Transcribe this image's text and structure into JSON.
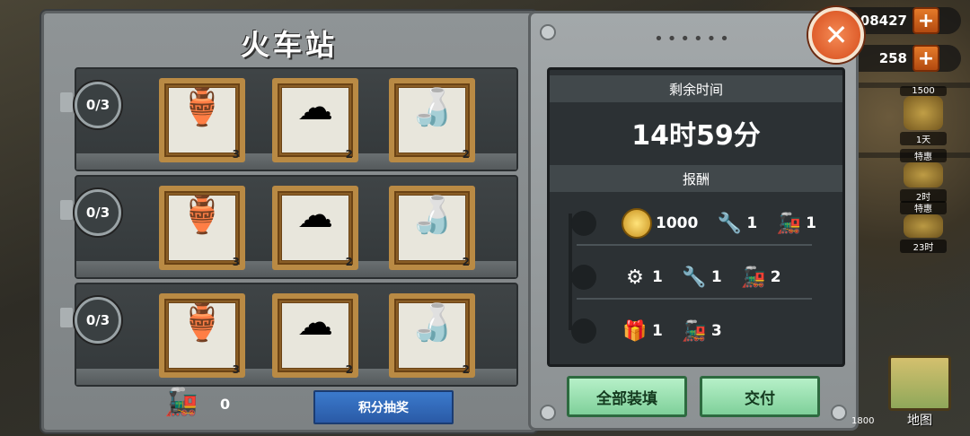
{
  "resources": [
    {
      "name": "coin",
      "value": "208427"
    },
    {
      "name": "gem",
      "value": "258"
    }
  ],
  "side_badges": [
    {
      "label": "1500"
    },
    {
      "label": "1天"
    },
    {
      "label": "特惠"
    },
    {
      "label": "2时"
    },
    {
      "label": "特惠"
    },
    {
      "label": "23时"
    }
  ],
  "station": {
    "title": "火车站",
    "orders": [
      {
        "progress": "0/3",
        "items": [
          {
            "name": "jug",
            "qty": "3"
          },
          {
            "name": "flour",
            "qty": "2"
          },
          {
            "name": "bottle",
            "qty": "2"
          }
        ]
      },
      {
        "progress": "0/3",
        "items": [
          {
            "name": "jug",
            "qty": "3"
          },
          {
            "name": "flour",
            "qty": "2"
          },
          {
            "name": "bottle",
            "qty": "2"
          }
        ]
      },
      {
        "progress": "0/3",
        "items": [
          {
            "name": "jug",
            "qty": "3"
          },
          {
            "name": "flour",
            "qty": "2"
          },
          {
            "name": "bottle",
            "qty": "2"
          }
        ]
      }
    ],
    "score": "0",
    "lottery_label": "积分抽奖"
  },
  "details": {
    "time_header": "剩余时间",
    "time_value": "14时59分",
    "reward_header": "报酬",
    "rewards": [
      [
        {
          "icon": "coin-icon",
          "qty": "1000"
        },
        {
          "icon": "wrench-icon",
          "qty": "1"
        },
        {
          "icon": "train-icon",
          "qty": "1"
        }
      ],
      [
        {
          "icon": "gear-icon",
          "qty": "1"
        },
        {
          "icon": "wrench-icon",
          "qty": "1"
        },
        {
          "icon": "train-icon",
          "qty": "2"
        }
      ],
      [
        {
          "icon": "gift-icon",
          "qty": "1"
        },
        {
          "icon": "train-icon",
          "qty": "3"
        }
      ]
    ],
    "load_all_label": "全部装填",
    "submit_label": "交付"
  },
  "map_label": "地图",
  "bottom_left_value": "1800"
}
